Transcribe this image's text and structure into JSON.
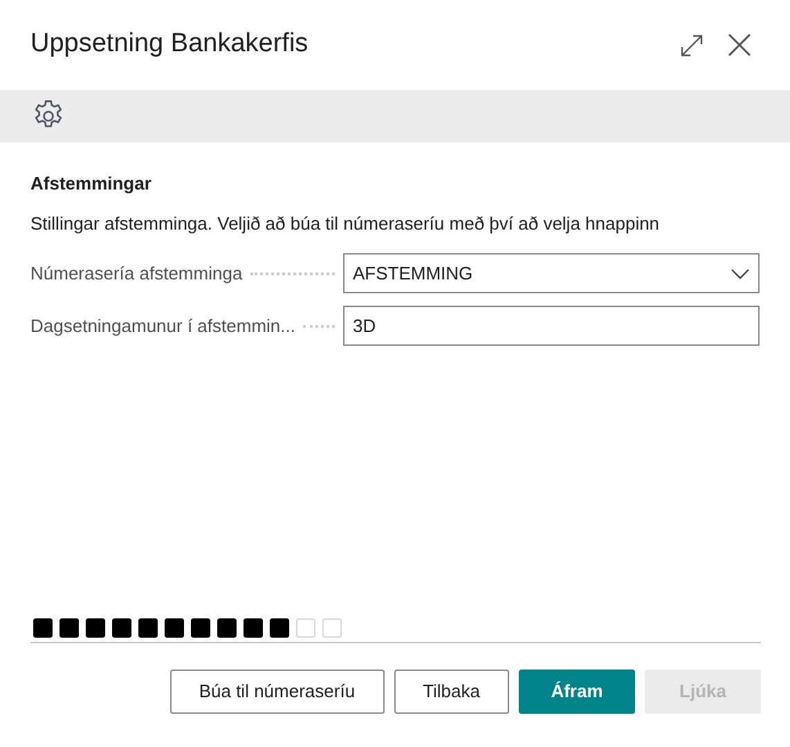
{
  "window": {
    "title": "Uppsetning Bankakerfis"
  },
  "section": {
    "title": "Afstemmingar",
    "description": "Stillingar afstemminga. Veljið að búa til númeraseríu með því að velja hnappinn"
  },
  "fields": [
    {
      "kind": "dropdown",
      "label": "Númerasería afstemminga",
      "value": "AFSTEMMING"
    },
    {
      "kind": "text",
      "label": "Dagsetningamunur í afstemmin...",
      "value": "3D"
    }
  ],
  "steps": [
    {
      "done": true
    },
    {
      "done": true
    },
    {
      "done": true
    },
    {
      "done": true
    },
    {
      "done": true
    },
    {
      "done": true
    },
    {
      "done": true
    },
    {
      "done": true
    },
    {
      "done": true
    },
    {
      "done": true
    },
    {
      "done": false
    },
    {
      "done": false
    }
  ],
  "buttons": [
    {
      "label": "Búa til númeraseríu",
      "kind": "secondary"
    },
    {
      "label": "Tilbaka",
      "kind": "secondary"
    },
    {
      "label": "Áfram",
      "kind": "primary"
    },
    {
      "label": "Ljúka",
      "kind": "disabled"
    }
  ]
}
